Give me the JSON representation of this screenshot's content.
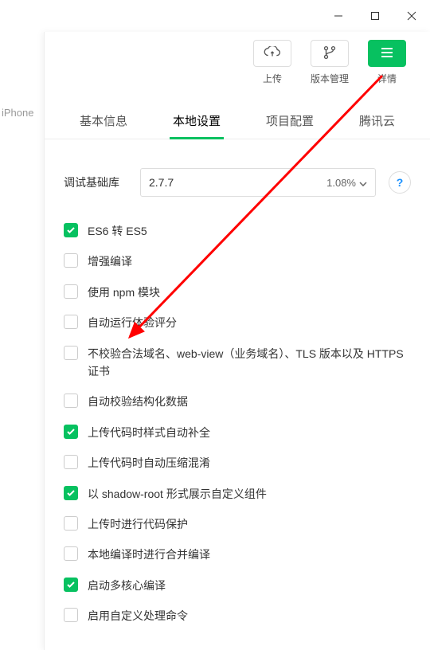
{
  "sidebar": {
    "device_hint": "iPhone"
  },
  "toolbar": {
    "upload_label": "上传",
    "version_label": "版本管理",
    "detail_label": "详情"
  },
  "tabs": {
    "basic": "基本信息",
    "local": "本地设置",
    "project": "项目配置",
    "cloud": "腾讯云"
  },
  "debug_lib": {
    "label": "调试基础库",
    "version": "2.7.7",
    "percent": "1.08%",
    "help": "?"
  },
  "options": [
    {
      "label": "ES6 转 ES5",
      "checked": true
    },
    {
      "label": "增强编译",
      "checked": false
    },
    {
      "label": "使用 npm 模块",
      "checked": false
    },
    {
      "label": "自动运行体验评分",
      "checked": false
    },
    {
      "label": "不校验合法域名、web-view（业务域名）、TLS 版本以及 HTTPS 证书",
      "checked": false
    },
    {
      "label": "自动校验结构化数据",
      "checked": false
    },
    {
      "label": "上传代码时样式自动补全",
      "checked": true
    },
    {
      "label": "上传代码时自动压缩混淆",
      "checked": false
    },
    {
      "label": "以 shadow-root 形式展示自定义组件",
      "checked": true
    },
    {
      "label": "上传时进行代码保护",
      "checked": false
    },
    {
      "label": "本地编译时进行合并编译",
      "checked": false
    },
    {
      "label": "启动多核心编译",
      "checked": true
    },
    {
      "label": "启用自定义处理命令",
      "checked": false
    }
  ]
}
